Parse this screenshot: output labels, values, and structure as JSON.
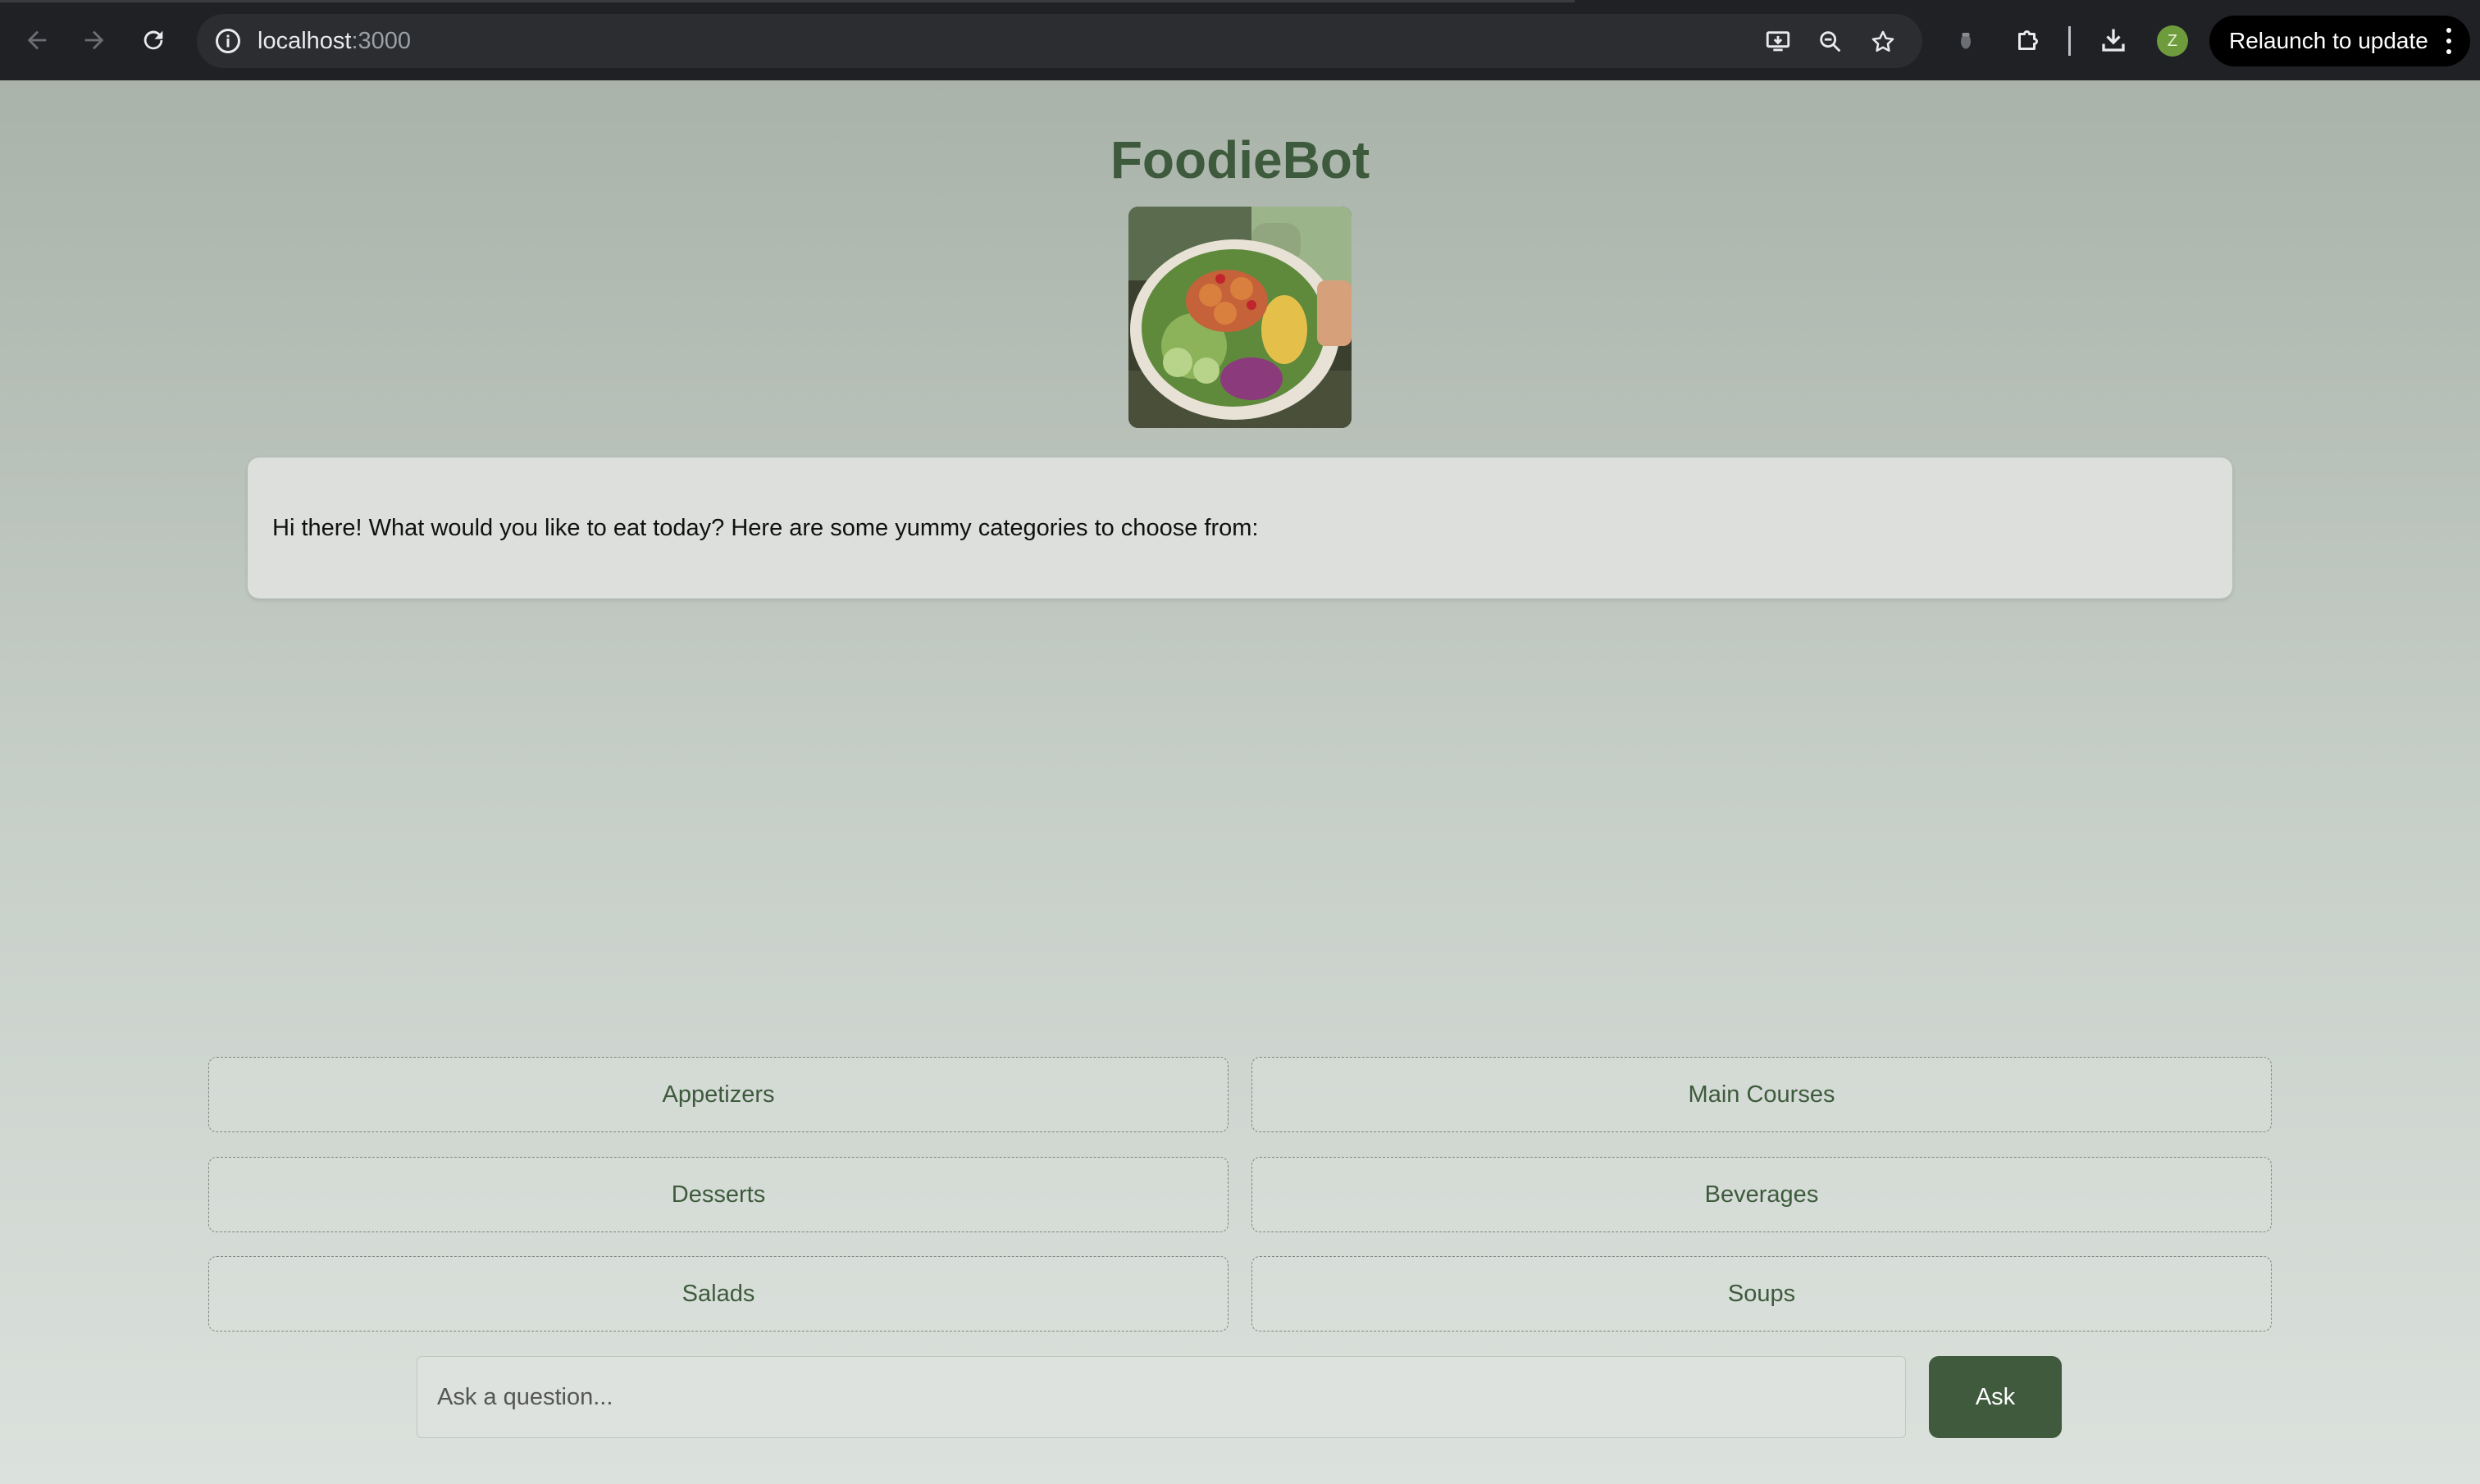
{
  "browser": {
    "url_host": "localhost",
    "url_port": ":3000",
    "profile_initial": "Z",
    "relaunch_label": "Relaunch to update"
  },
  "app": {
    "title": "FoodieBot",
    "greeting": "Hi there! What would you like to eat today? Here are some yummy categories to choose from:"
  },
  "categories": [
    {
      "label": "Appetizers"
    },
    {
      "label": "Main Courses"
    },
    {
      "label": "Desserts"
    },
    {
      "label": "Beverages"
    },
    {
      "label": "Salads"
    },
    {
      "label": "Soups"
    }
  ],
  "ask": {
    "placeholder": "Ask a question...",
    "button_label": "Ask"
  },
  "colors": {
    "accent": "#3f5a3d",
    "title": "#3e5a3c"
  }
}
